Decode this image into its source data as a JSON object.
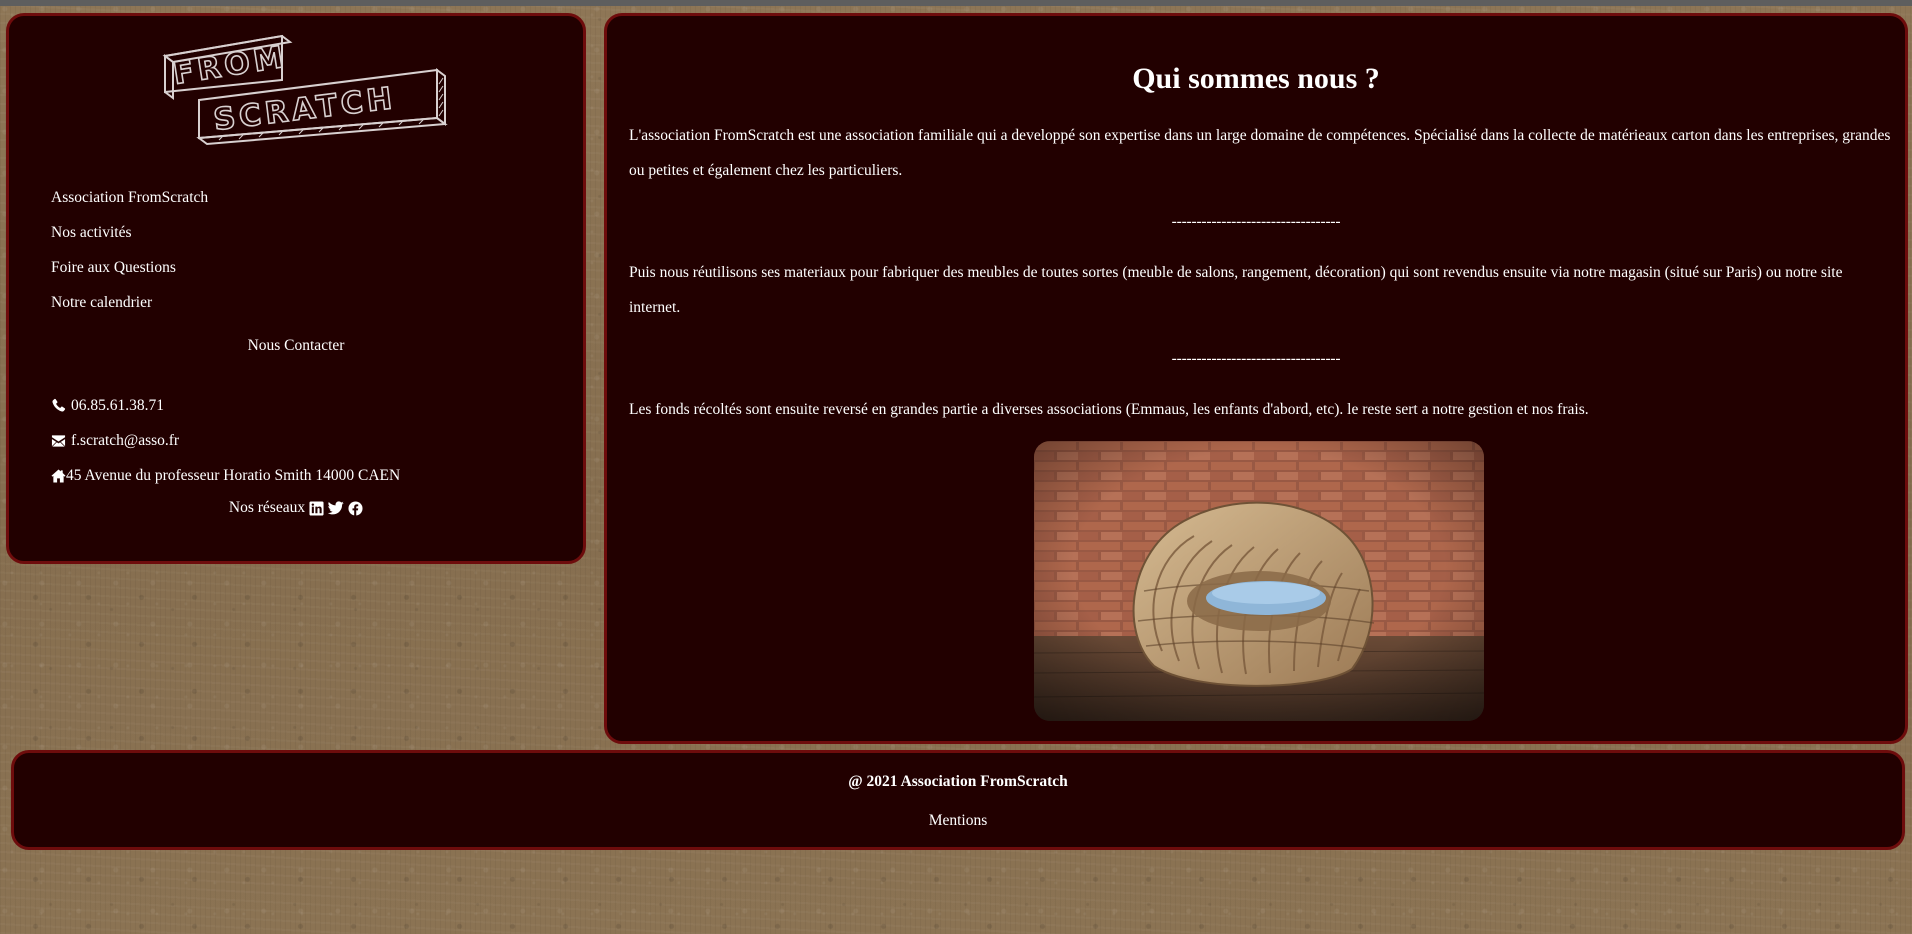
{
  "colors": {
    "panel_background": "#220000",
    "panel_border": "#6e0c0c",
    "page_background": "#8a7353",
    "text": "#ffffff"
  },
  "brand": {
    "logo_line1": "FROM",
    "logo_line2": "SCRATCH"
  },
  "sidebar": {
    "nav": [
      {
        "label": "Association FromScratch"
      },
      {
        "label": "Nos activités"
      },
      {
        "label": "Foire aux Questions"
      },
      {
        "label": "Notre calendrier"
      }
    ],
    "contact": {
      "heading": "Nous Contacter",
      "phone": {
        "icon": "phone-icon",
        "text": "06.85.61.38.71"
      },
      "email": {
        "icon": "envelope-icon",
        "text": "f.scratch@asso.fr"
      },
      "address": {
        "icon": "home-icon",
        "text": "45 Avenue du professeur Horatio Smith 14000 CAEN"
      }
    },
    "social": {
      "label": "Nos réseaux",
      "icons": [
        "linkedin-icon",
        "twitter-icon",
        "facebook-icon"
      ]
    }
  },
  "main": {
    "title": "Qui sommes nous ?",
    "paragraphs": [
      "L'association FromScratch est une association familiale qui a developpé son expertise dans un large domaine de compétences. Spécialisé dans la collecte de matérieaux carton dans les entreprises, grandes ou petites et également chez les particuliers.",
      "Puis nous réutilisons ses materiaux pour fabriquer des meubles de toutes sortes (meuble de salons, rangement, décoration) qui sont revendus ensuite via notre magasin (situé sur Paris) ou notre site internet.",
      "Les fonds récoltés sont ensuite reversé en grandes partie a diverses associations (Emmaus, les enfants d'abord, etc). le reste sert a notre gestion et nos frais."
    ],
    "separator": "----------------------------------",
    "image": {
      "subject": "cardboard armchair with blue cushion in front of a brick wall"
    }
  },
  "footer": {
    "copyright": "@ 2021 Association FromScratch",
    "mentions": "Mentions"
  }
}
